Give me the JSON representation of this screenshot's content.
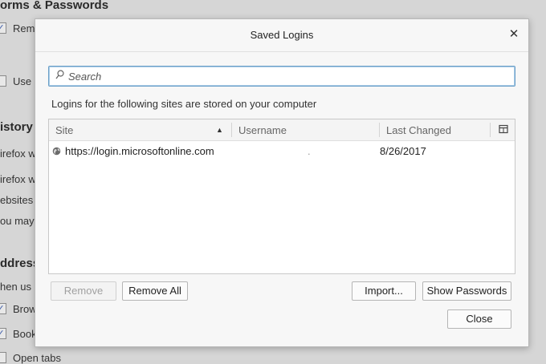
{
  "background": {
    "section_forms": "orms & Passwords",
    "remember_label": "Rem",
    "use_label": "Use",
    "section_history": "istory",
    "history_line1": "irefox w",
    "history_line2": "irefox w",
    "history_line3": "ebsites",
    "history_line4": "ou may",
    "section_address": "ddress",
    "address_line1": "hen us",
    "address_item1": "Brow",
    "address_item2": "Book",
    "address_item3": "Open tabs",
    "check_glyph": "✓"
  },
  "dialog": {
    "title": "Saved Logins",
    "close_glyph": "✕",
    "search_placeholder": "Search",
    "info_text": "Logins for the following sites are stored on your computer",
    "columns": {
      "site": "Site",
      "username": "Username",
      "last_changed": "Last Changed"
    },
    "sort_glyph": "▲",
    "rows": [
      {
        "site": "https://login.microsoftonline.com",
        "username": ".",
        "last_changed": "8/26/2017"
      }
    ],
    "buttons": {
      "remove": "Remove",
      "remove_all": "Remove All",
      "import": "Import...",
      "show_passwords": "Show Passwords",
      "close": "Close"
    }
  },
  "colors": {
    "accent": "#6ba0c8",
    "background": "#d6d6d6",
    "dialog_bg": "#f7f7f7"
  }
}
